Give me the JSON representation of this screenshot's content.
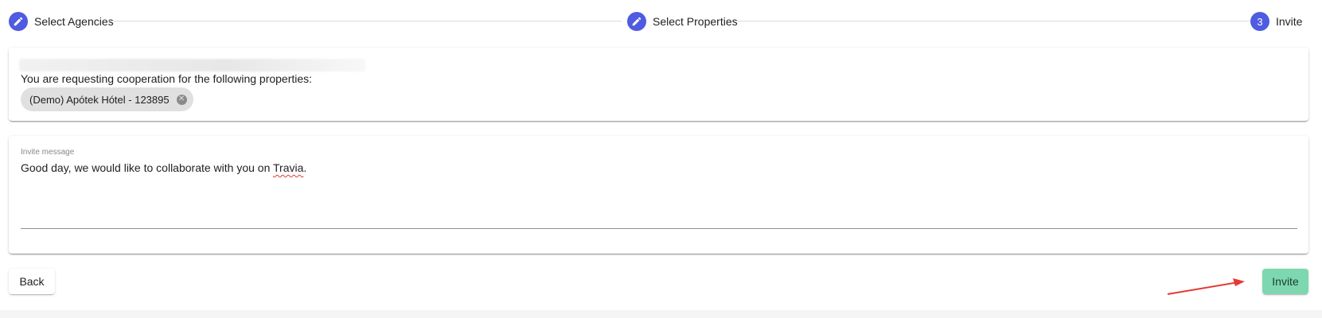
{
  "stepper": {
    "steps": [
      {
        "label": "Select Agencies",
        "icon": "pencil-icon",
        "state": "completed"
      },
      {
        "label": "Select Properties",
        "icon": "pencil-icon",
        "state": "completed"
      },
      {
        "label": "Invite",
        "number": "3",
        "state": "active"
      }
    ]
  },
  "properties_card": {
    "request_text": "You are requesting cooperation for the following properties:",
    "chips": [
      {
        "label": "(Demo) Apótek Hótel - 123895",
        "delete_glyph": "✕"
      }
    ]
  },
  "message_card": {
    "label": "Invite message",
    "value_prefix": "Good day, we would like to collaborate with you on ",
    "value_highlight": "Travia",
    "value_suffix": "."
  },
  "actions": {
    "back_label": "Back",
    "invite_label": "Invite"
  },
  "colors": {
    "step_active": "#4f5be0",
    "invite_button": "#7dd8b0",
    "annotation_arrow": "#e53935"
  }
}
